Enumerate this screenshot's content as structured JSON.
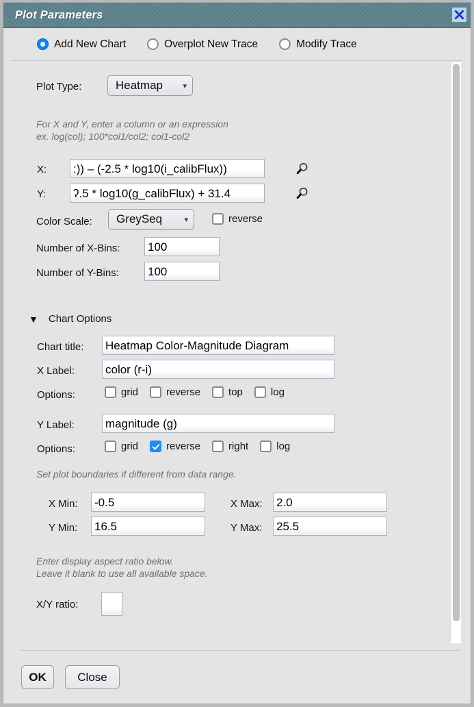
{
  "window": {
    "title": "Plot Parameters",
    "close_icon": "close-x-icon"
  },
  "modes": [
    {
      "label": "Add New Chart",
      "selected": true
    },
    {
      "label": "Overplot New Trace",
      "selected": false
    },
    {
      "label": "Modify Trace",
      "selected": false
    }
  ],
  "plot_type": {
    "label": "Plot Type:",
    "value": "Heatmap",
    "caret_icon": "chevron-down-icon"
  },
  "expression_hint": "For X and Y, enter a column or an expression\nex. log(col); 100*col1/col2; col1-col2",
  "x_field": {
    "label": "X:",
    "value": ":)) – (-2.5 * log10(i_calibFlux))",
    "search_icon": "magnifier-icon"
  },
  "y_field": {
    "label": "Y:",
    "value": "ʔ.5 * log10(g_calibFlux) + 31.4",
    "search_icon": "magnifier-icon"
  },
  "color_scale": {
    "label": "Color Scale:",
    "value": "GreySeq",
    "caret_icon": "chevron-down-icon",
    "reverse_label": "reverse",
    "reverse_checked": false
  },
  "x_bins": {
    "label": "Number of X-Bins:",
    "value": "100"
  },
  "y_bins": {
    "label": "Number of Y-Bins:",
    "value": "100"
  },
  "chart_options": {
    "disclosure_icon": "triangle-down-icon",
    "section_label": "Chart Options",
    "chart_title": {
      "label": "Chart title:",
      "value": "Heatmap Color-Magnitude Diagram"
    },
    "x_label": {
      "label": "X Label:",
      "value": "color (r-i)"
    },
    "x_options": {
      "label": "Options:",
      "items": [
        {
          "label": "grid",
          "checked": false
        },
        {
          "label": "reverse",
          "checked": false
        },
        {
          "label": "top",
          "checked": false
        },
        {
          "label": "log",
          "checked": false
        }
      ]
    },
    "y_label": {
      "label": "Y Label:",
      "value": "magnitude (g)"
    },
    "y_options": {
      "label": "Options:",
      "items": [
        {
          "label": "grid",
          "checked": false
        },
        {
          "label": "reverse",
          "checked": true
        },
        {
          "label": "right",
          "checked": false
        },
        {
          "label": "log",
          "checked": false
        }
      ]
    },
    "boundaries_hint": "Set plot boundaries if different from data range.",
    "x_min": {
      "label": "X Min:",
      "value": "-0.5"
    },
    "x_max": {
      "label": "X Max:",
      "value": "2.0"
    },
    "y_min": {
      "label": "Y Min:",
      "value": "16.5"
    },
    "y_max": {
      "label": "Y Max:",
      "value": "25.5"
    },
    "aspect_hint": "Enter display aspect ratio below.\nLeave it blank to use all available space.",
    "ratio": {
      "label": "X/Y ratio:",
      "value": ""
    }
  },
  "footer": {
    "ok_label": "OK",
    "close_label": "Close"
  },
  "colors": {
    "titlebar": "#5c8089",
    "accent_blue": "#0a84ff",
    "checkbox_blue": "#1a8cff",
    "dialog_bg": "#e4e4e4"
  }
}
